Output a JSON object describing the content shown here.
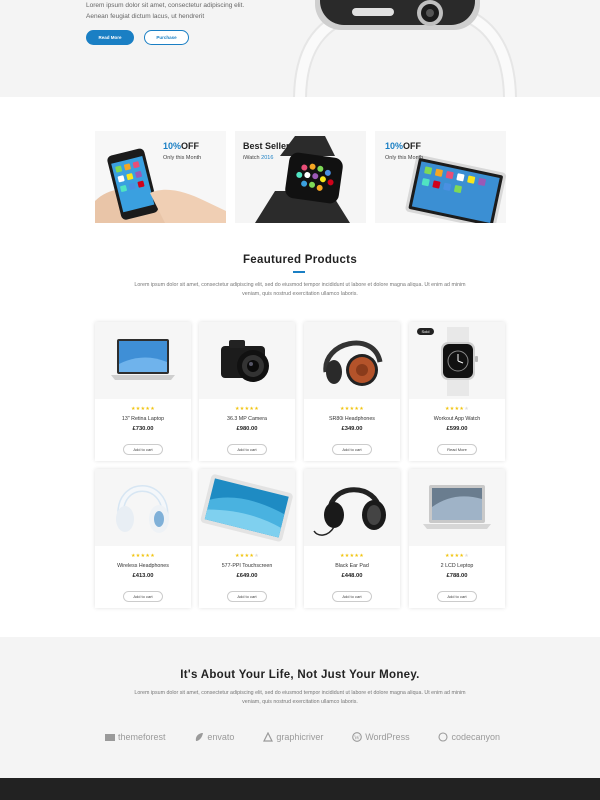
{
  "hero": {
    "line1": "Lorem ipsum dolor sit amet, consectetur adipiscing elit.",
    "line2": "Aenean feugiat dictum lacus, ut hendrerit",
    "read_more": "Read More",
    "purchase": "Purchase"
  },
  "promos": [
    {
      "title_accent": "10%",
      "title_rest": "OFF",
      "subtitle": "Only this Month"
    },
    {
      "title": "Best Seller",
      "sub_prefix": "iWatch ",
      "sub_accent": "2016"
    },
    {
      "title_accent": "10%",
      "title_rest": "OFF",
      "subtitle": "Only this Month"
    }
  ],
  "featured": {
    "title": "Feautured Products",
    "description": "Lorem ipsum dolor sit amet, consectetur adipiscing elit, sed do eiusmod tempor incididunt ut labore et dolore magna aliqua. Ut enim ad minim veniam, quis nostrud exercitation ullamco laboris."
  },
  "products": [
    {
      "name": "13\" Retina Laptop",
      "price": "£730.00",
      "rating": 5,
      "button": "Add to cart"
    },
    {
      "name": "36.3 MP Camera",
      "price": "£980.00",
      "rating": 5,
      "button": "Add to cart"
    },
    {
      "name": "SR80i Headphones",
      "price": "£349.00",
      "rating": 5,
      "button": "Add to cart"
    },
    {
      "name": "Workout App Watch",
      "price": "£599.00",
      "rating": 4,
      "button": "Read More",
      "badge": "Sold"
    },
    {
      "name": "Wireless Headphones",
      "price": "£413.00",
      "rating": 5,
      "button": "Add to cart"
    },
    {
      "name": "577-PPI Touchscreen",
      "price": "£649.00",
      "rating": 4,
      "button": "Add to cart"
    },
    {
      "name": "Black Ear Pad",
      "price": "£448.00",
      "rating": 5,
      "button": "Add to cart"
    },
    {
      "name": "2 LCD Leptop",
      "price": "£788.00",
      "rating": 4,
      "button": "Add to cart"
    }
  ],
  "about": {
    "title": "It's About Your Life, Not Just Your Money.",
    "description": "Lorem ipsum dolor sit amet, consectetur adipiscing elit, sed do eiusmod tempor incididunt ut labore et dolore magna aliqua. Ut enim ad minim veniam, quis nostrud exercitation ullamco laboris."
  },
  "partners": [
    "themeforest",
    "envato",
    "graphicriver",
    "WordPress",
    "codecanyon"
  ],
  "colors": {
    "accent": "#1a7fc4",
    "star": "#f1c40f",
    "footer": "#222222"
  }
}
